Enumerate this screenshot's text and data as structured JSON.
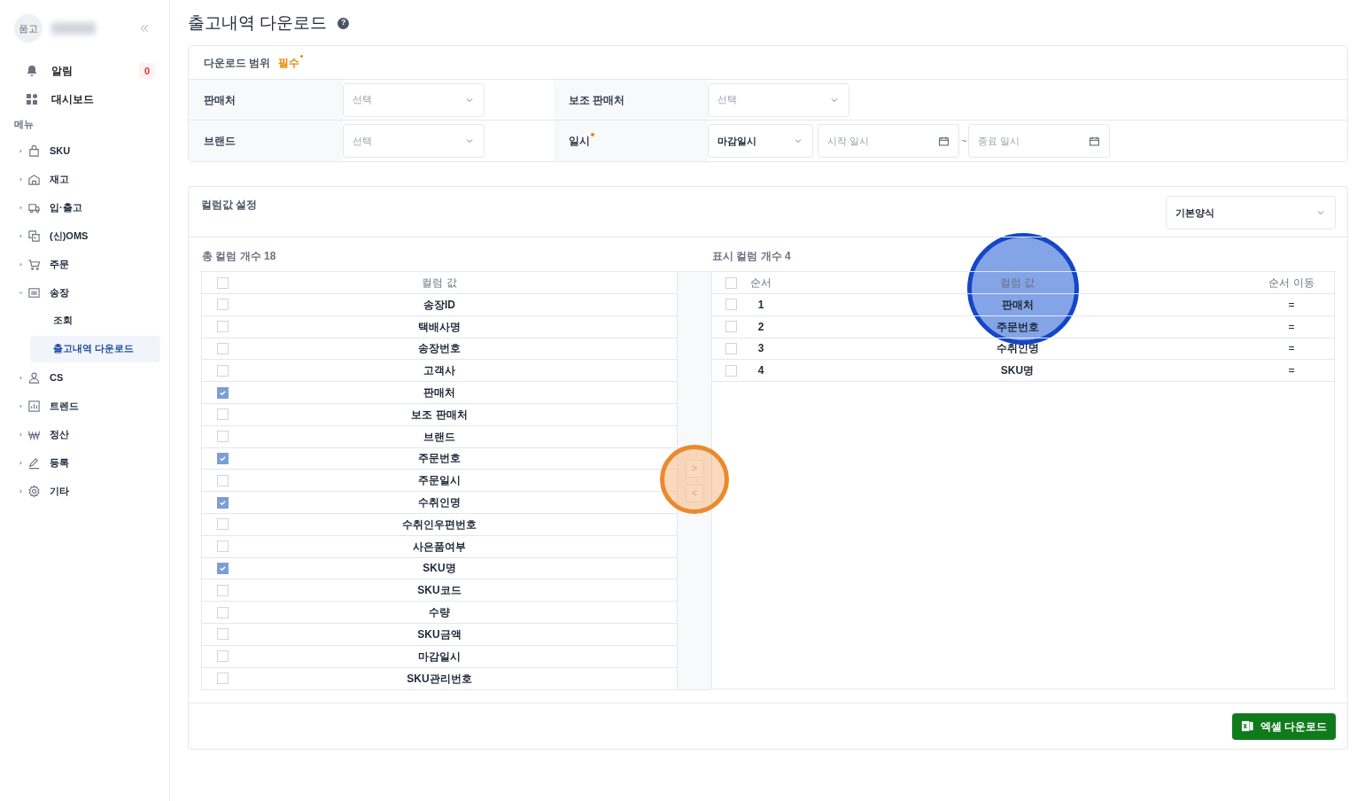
{
  "sidebar": {
    "avatar": "품고",
    "badge_count": "0",
    "top_items": [
      {
        "label": "알림",
        "kind": "bell"
      },
      {
        "label": "대시보드",
        "kind": "dashboard"
      }
    ],
    "section": "메뉴",
    "items": [
      {
        "label": "SKU",
        "kind": "bag",
        "expanded": false
      },
      {
        "label": "재고",
        "kind": "house",
        "expanded": false
      },
      {
        "label": "입·출고",
        "kind": "truck",
        "expanded": false
      },
      {
        "label": "(신)OMS",
        "kind": "oms",
        "expanded": false
      },
      {
        "label": "주문",
        "kind": "cart",
        "expanded": false
      },
      {
        "label": "송장",
        "kind": "list",
        "expanded": true,
        "children": [
          {
            "label": "조회",
            "selected": false
          },
          {
            "label": "출고내역 다운로드",
            "selected": true
          }
        ]
      },
      {
        "label": "CS",
        "kind": "person",
        "expanded": false
      },
      {
        "label": "트렌드",
        "kind": "chart",
        "expanded": false
      },
      {
        "label": "정산",
        "kind": "won",
        "expanded": false
      },
      {
        "label": "등록",
        "kind": "pen",
        "expanded": false
      },
      {
        "label": "기타",
        "kind": "gear",
        "expanded": false
      }
    ]
  },
  "page": {
    "title": "출고내역 다운로드",
    "help": "?"
  },
  "range": {
    "title": "다운로드 범위",
    "required": "필수",
    "fields": [
      {
        "label": "판매처",
        "required": false,
        "placeholder": "선택"
      },
      {
        "label": "보조 판매처",
        "required": false,
        "placeholder": "선택"
      },
      {
        "label": "브랜드",
        "required": false,
        "placeholder": "선택"
      },
      {
        "label": "일시",
        "required": true,
        "value": "마감일시",
        "start_placeholder": "시작 일시",
        "separator": "~",
        "end_placeholder": "종료 일시"
      }
    ]
  },
  "columns": {
    "title": "컬럼값 설정",
    "preset": "기본양식",
    "total_label": "총 컬럼 개수 18",
    "left_header": "컬럼 값",
    "left_all_checked": false,
    "right_all_checked": false,
    "left_rows": [
      {
        "label": "송장ID",
        "checked": false
      },
      {
        "label": "택배사명",
        "checked": false
      },
      {
        "label": "송장번호",
        "checked": false
      },
      {
        "label": "고객사",
        "checked": false
      },
      {
        "label": "판매처",
        "checked": true
      },
      {
        "label": "보조 판매처",
        "checked": false
      },
      {
        "label": "브랜드",
        "checked": false
      },
      {
        "label": "주문번호",
        "checked": true
      },
      {
        "label": "주문일시",
        "checked": false
      },
      {
        "label": "수취인명",
        "checked": true
      },
      {
        "label": "수취인우편번호",
        "checked": false
      },
      {
        "label": "사은품여부",
        "checked": false
      },
      {
        "label": "SKU명",
        "checked": true
      },
      {
        "label": "SKU코드",
        "checked": false
      },
      {
        "label": "수량",
        "checked": false
      },
      {
        "label": "SKU금액",
        "checked": false
      },
      {
        "label": "마감일시",
        "checked": false
      },
      {
        "label": "SKU관리번호",
        "checked": false
      }
    ],
    "move_buttons": [
      ">",
      "<"
    ],
    "shown_label": "표시 컬럼 개수 4",
    "right_headers": [
      "순서",
      "컬럼 값",
      "순서 이동"
    ],
    "right_rows": [
      {
        "order": "1",
        "label": "판매처",
        "move": "=",
        "checked": false
      },
      {
        "order": "2",
        "label": "주문번호",
        "move": "=",
        "checked": false
      },
      {
        "order": "3",
        "label": "수취인명",
        "move": "=",
        "checked": false
      },
      {
        "order": "4",
        "label": "SKU명",
        "move": "=",
        "checked": false
      }
    ]
  },
  "download_button": "엑셀 다운로드"
}
